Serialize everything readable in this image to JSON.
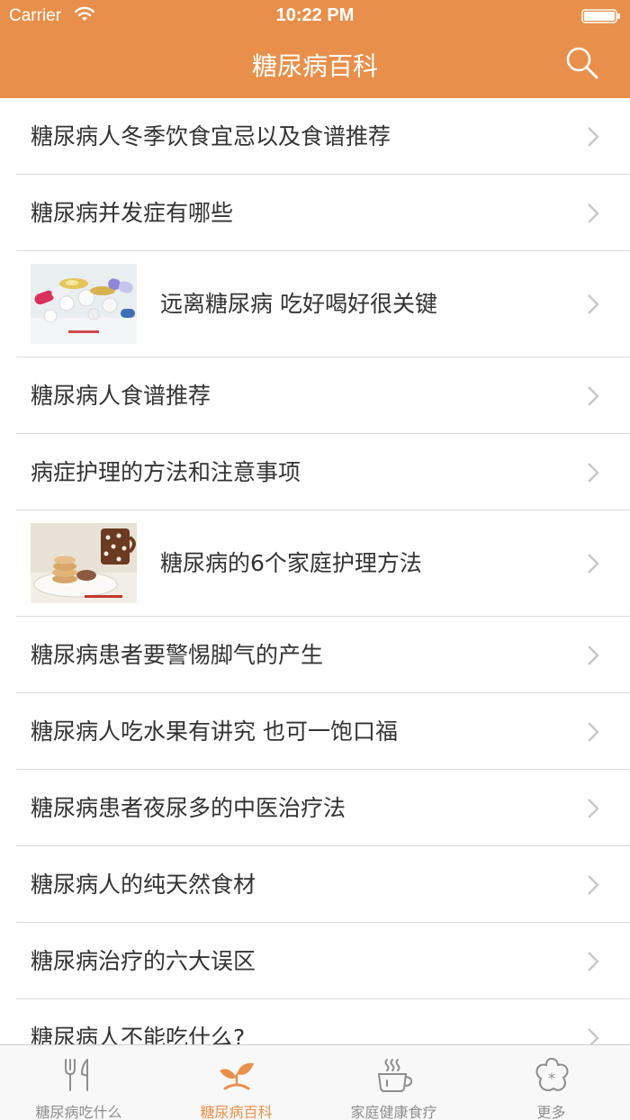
{
  "status_bar": {
    "carrier": "Carrier",
    "time": "10:22 PM"
  },
  "nav_bar": {
    "title": "糖尿病百科",
    "search_icon": "search-icon"
  },
  "accent_color": "#E8904B",
  "list": {
    "items": [
      {
        "label": "糖尿病人冬季饮食宜忌以及食谱推荐",
        "has_image": false
      },
      {
        "label": "糖尿病并发症有哪些",
        "has_image": false
      },
      {
        "label": "远离糖尿病 吃好喝好很关键",
        "has_image": true,
        "image": "pills-photo"
      },
      {
        "label": "糖尿病人食谱推荐",
        "has_image": false
      },
      {
        "label": "病症护理的方法和注意事项",
        "has_image": false
      },
      {
        "label": "糖尿病的6个家庭护理方法",
        "has_image": true,
        "image": "cookies-and-mug-photo"
      },
      {
        "label": "糖尿病患者要警惕脚气的产生",
        "has_image": false
      },
      {
        "label": "糖尿病人吃水果有讲究 也可一饱口福",
        "has_image": false
      },
      {
        "label": "糖尿病患者夜尿多的中医治疗法",
        "has_image": false
      },
      {
        "label": "糖尿病人的纯天然食材",
        "has_image": false
      },
      {
        "label": "糖尿病治疗的六大误区",
        "has_image": false
      },
      {
        "label": "糖尿病人不能吃什么?",
        "has_image": false
      }
    ]
  },
  "tab_bar": {
    "tabs": [
      {
        "label": "糖尿病吃什么",
        "icon": "fork-knife-icon",
        "active": false
      },
      {
        "label": "糖尿病百科",
        "icon": "sprout-icon",
        "active": true
      },
      {
        "label": "家庭健康食疗",
        "icon": "coffee-cup-icon",
        "active": false
      },
      {
        "label": "更多",
        "icon": "flower-star-icon",
        "active": false
      }
    ]
  }
}
